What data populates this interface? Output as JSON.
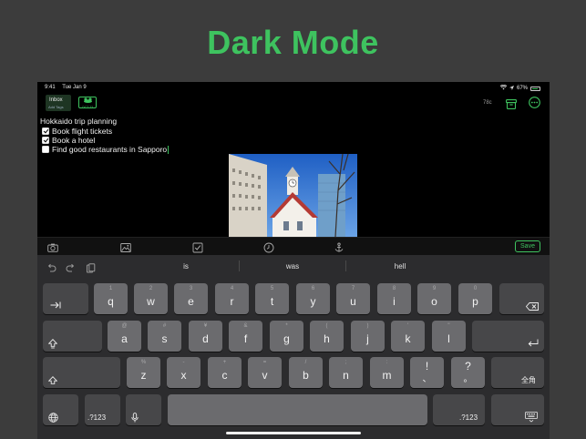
{
  "headline": "Dark Mode",
  "status": {
    "time": "9:41",
    "date": "Tue Jan 9",
    "battery": "67%"
  },
  "toolbar": {
    "inbox_label": "Inbox",
    "tags_label": "Add Tags",
    "calendar_date": "OCT 23",
    "word_count": "78c"
  },
  "note": {
    "title": "Hokkaido trip planning",
    "items": [
      {
        "text": "Book flight tickets",
        "checked": true
      },
      {
        "text": "Book a hotel",
        "checked": true
      },
      {
        "text": "Find good restaurants in Sapporo",
        "checked": false
      }
    ]
  },
  "format_bar": {
    "save_label": "Save"
  },
  "suggestions": [
    "is",
    "was",
    "hell"
  ],
  "keys": {
    "row1": [
      {
        "main": "q",
        "alt": "1"
      },
      {
        "main": "w",
        "alt": "2"
      },
      {
        "main": "e",
        "alt": "3"
      },
      {
        "main": "r",
        "alt": "4"
      },
      {
        "main": "t",
        "alt": "5"
      },
      {
        "main": "y",
        "alt": "6"
      },
      {
        "main": "u",
        "alt": "7"
      },
      {
        "main": "i",
        "alt": "8"
      },
      {
        "main": "o",
        "alt": "9"
      },
      {
        "main": "p",
        "alt": "0"
      }
    ],
    "row2": [
      {
        "main": "a",
        "alt": "@"
      },
      {
        "main": "s",
        "alt": "#"
      },
      {
        "main": "d",
        "alt": "¥"
      },
      {
        "main": "f",
        "alt": "&"
      },
      {
        "main": "g",
        "alt": "*"
      },
      {
        "main": "h",
        "alt": "("
      },
      {
        "main": "j",
        "alt": ")"
      },
      {
        "main": "k",
        "alt": "'"
      },
      {
        "main": "l",
        "alt": "\""
      }
    ],
    "row3": [
      {
        "main": "z",
        "alt": "%"
      },
      {
        "main": "x",
        "alt": "-"
      },
      {
        "main": "c",
        "alt": "+"
      },
      {
        "main": "v",
        "alt": "="
      },
      {
        "main": "b",
        "alt": "/"
      },
      {
        "main": "n",
        "alt": ";"
      },
      {
        "main": "m",
        "alt": ":"
      },
      {
        "main": "!",
        "alt": "、"
      },
      {
        "main": "?",
        "alt": "。"
      }
    ],
    "numbers_left": ".?123",
    "numbers_right": ".?123",
    "kana_label": "全角"
  },
  "colors": {
    "accent": "#3ec35f",
    "background": "#3c3c3c",
    "key": "#6b6b6e",
    "key_dark": "#474749"
  }
}
